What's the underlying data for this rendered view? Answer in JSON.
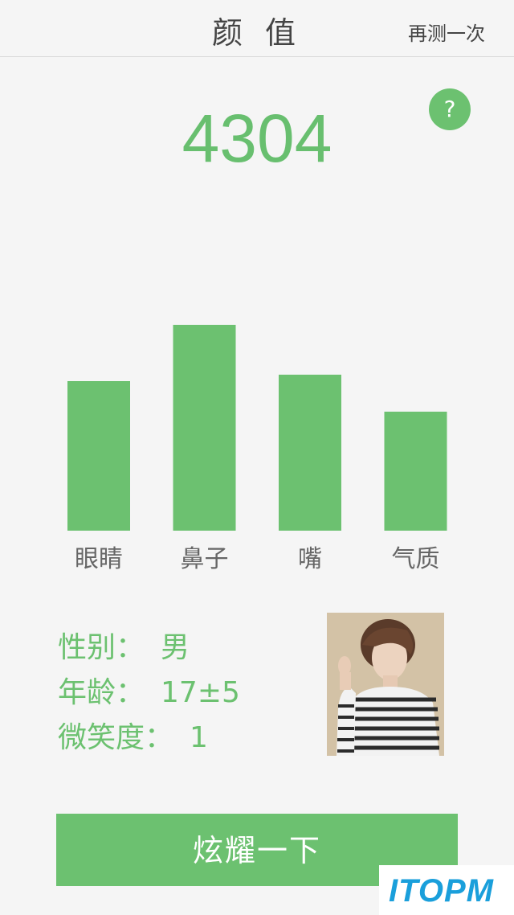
{
  "header": {
    "title": "颜 值",
    "retest_label": "再测一次"
  },
  "help": {
    "icon": "question-icon",
    "glyph": "?"
  },
  "score": "4304",
  "chart_data": {
    "type": "bar",
    "categories": [
      "眼睛",
      "鼻子",
      "嘴",
      "气质"
    ],
    "values": [
      186,
      256,
      194,
      148
    ],
    "color": "#6cc170"
  },
  "info": {
    "gender_label": "性别：",
    "gender_value": "男",
    "age_label": "年龄：",
    "age_value": "17±5",
    "smile_label": "微笑度：",
    "smile_value": "1"
  },
  "action_label": "炫耀一下",
  "watermark": "ITOPM"
}
